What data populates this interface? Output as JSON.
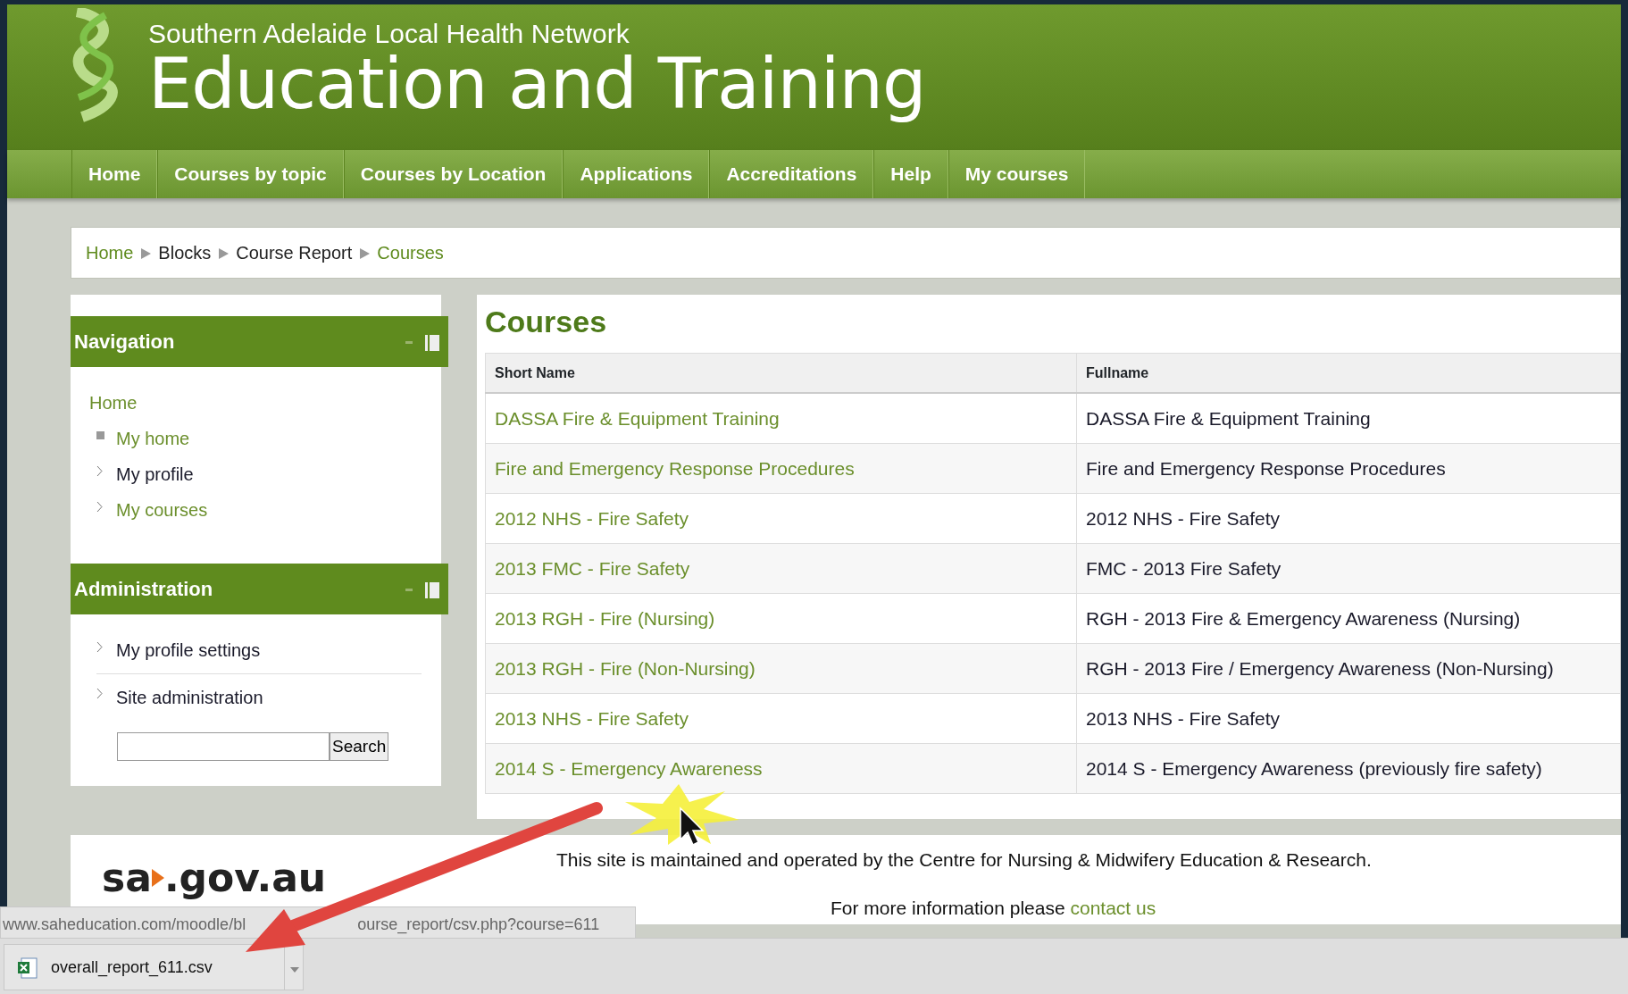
{
  "header": {
    "subtitle": "Southern Adelaide Local Health Network",
    "title": "Education and Training"
  },
  "nav": [
    "Home",
    "Courses by topic",
    "Courses by Location",
    "Applications",
    "Accreditations",
    "Help",
    "My courses"
  ],
  "breadcrumb": [
    {
      "label": "Home",
      "link": true
    },
    {
      "label": "Blocks",
      "link": false
    },
    {
      "label": "Course Report",
      "link": false
    },
    {
      "label": "Courses",
      "link": true
    }
  ],
  "navigation_block": {
    "title": "Navigation",
    "items": [
      {
        "label": "Home",
        "link": true,
        "kind": "root",
        "children": [
          {
            "label": "My home",
            "link": true,
            "kind": "leaf"
          },
          {
            "label": "My profile",
            "link": false,
            "kind": "branch"
          },
          {
            "label": "My courses",
            "link": true,
            "kind": "branch"
          }
        ]
      }
    ]
  },
  "administration_block": {
    "title": "Administration",
    "items": [
      {
        "label": "My profile settings",
        "kind": "branch"
      },
      {
        "label": "Site administration",
        "kind": "branch"
      }
    ],
    "search_button": "Search"
  },
  "courses": {
    "heading": "Courses",
    "columns": [
      "Short Name",
      "Fullname"
    ],
    "rows": [
      [
        "DASSA Fire & Equipment Training",
        "DASSA Fire & Equipment Training"
      ],
      [
        "Fire and Emergency Response Procedures",
        "Fire and Emergency Response Procedures"
      ],
      [
        "2012 NHS - Fire Safety",
        "2012 NHS - Fire Safety"
      ],
      [
        "2013 FMC - Fire Safety",
        "FMC - 2013 Fire Safety"
      ],
      [
        "2013 RGH - Fire (Nursing)",
        "RGH - 2013 Fire & Emergency Awareness (Nursing)"
      ],
      [
        "2013 RGH - Fire (Non-Nursing)",
        "RGH - 2013 Fire / Emergency Awareness (Non-Nursing)"
      ],
      [
        "2013 NHS - Fire Safety",
        "2013 NHS - Fire Safety"
      ],
      [
        "2014 S - Emergency Awareness",
        "2014 S - Emergency Awareness (previously fire safety)"
      ]
    ]
  },
  "footer": {
    "logo_left": "sa",
    "logo_right": ".gov.au",
    "line_1": "This site is maintained and operated by the Centre for Nursing & Midwifery Education & Research.",
    "line_2": "For more information please",
    "link": "contact us"
  },
  "status_bar": {
    "url_parts": [
      "www.saheducation.com/moodle/bl",
      "ourse_report/csv.php?course=611"
    ]
  },
  "download_bar": {
    "file": "overall_report_611.csv"
  }
}
